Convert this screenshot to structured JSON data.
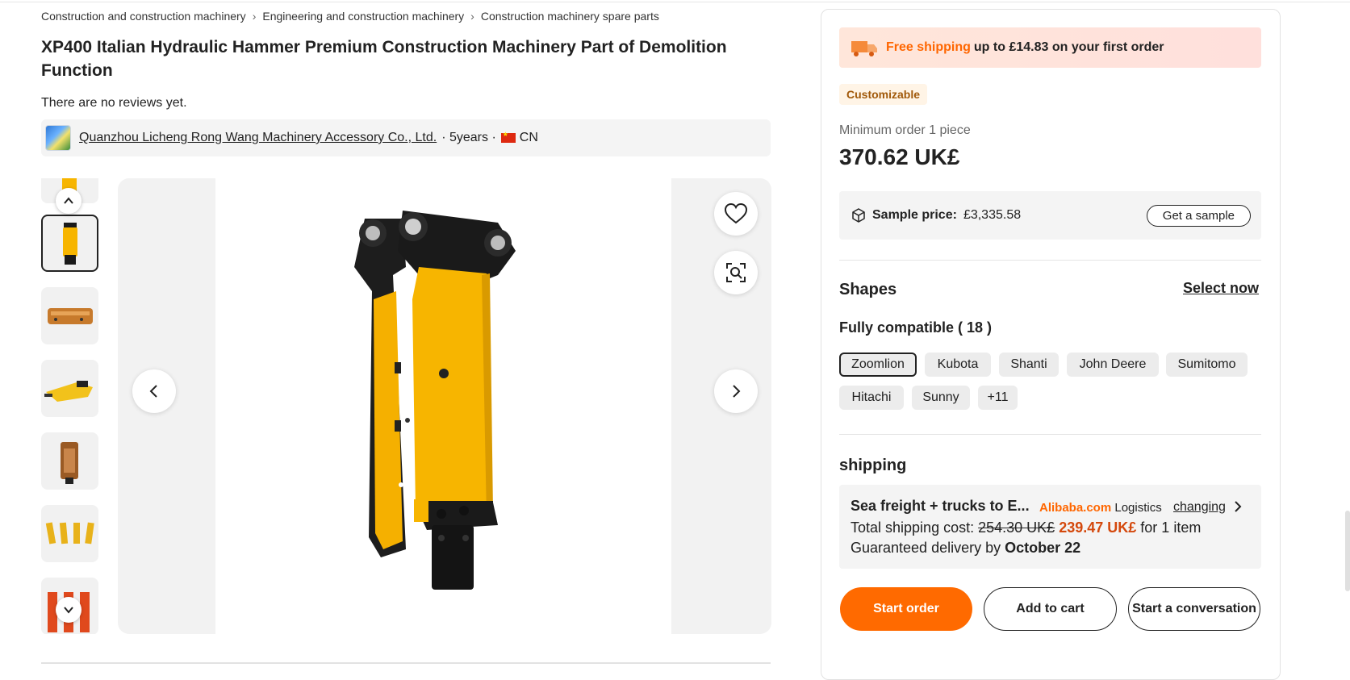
{
  "breadcrumb": {
    "items": [
      "Construction and construction machinery",
      "Engineering and construction machinery",
      "Construction machinery spare parts"
    ],
    "separator": ">"
  },
  "product": {
    "title": "XP400 Italian Hydraulic Hammer Premium Construction Machinery Part of Demolition Function",
    "reviews_text": "There are no reviews yet."
  },
  "supplier": {
    "name": "Quanzhou Licheng Rong Wang Machinery Accessory Co., Ltd.",
    "years": "· 5years ·",
    "country": "CN"
  },
  "gallery": {
    "thumbnail_count": 7,
    "active_thumbnail": 1,
    "icons": {
      "favorite": "heart-icon",
      "visual_search": "image-search-icon",
      "prev": "chevron-left-icon",
      "next": "chevron-right-icon",
      "thumb_up": "chevron-up-icon",
      "thumb_down": "chevron-down-icon"
    }
  },
  "promo": {
    "highlight": "Free shipping",
    "rest": "up to £14.83 on your first order"
  },
  "pricing": {
    "tag": "Customizable",
    "min_order": "Minimum order 1 piece",
    "price": "370.62 UK£",
    "sample_label": "Sample price:",
    "sample_value": "£3,335.58",
    "sample_button": "Get a sample"
  },
  "shapes": {
    "title": "Shapes",
    "select_now": "Select now",
    "compat_label": "Fully compatible ( 18 )",
    "chips": [
      "Zoomlion",
      "Kubota",
      "Shanti",
      "John Deere",
      "Sumitomo",
      "Hitachi",
      "Sunny",
      "+11"
    ],
    "selected": "Zoomlion"
  },
  "shipping": {
    "title": "shipping",
    "method": "Sea freight + trucks to E...",
    "brand": "Alibaba.com",
    "brand_suffix": "Logistics",
    "change": "changing",
    "cost_label": "Total shipping cost:",
    "old_cost": "254.30 UK£",
    "new_cost": "239.47 UK£",
    "cost_suffix": "for 1 item",
    "delivery_label": "Guaranteed delivery by",
    "delivery_date": "October 22"
  },
  "actions": {
    "start_order": "Start order",
    "add_to_cart": "Add to cart",
    "conversation": "Start a conversation"
  },
  "colors": {
    "accent": "#ff6a00",
    "hammer_yellow": "#f7b500",
    "hammer_black": "#1a1a1a"
  }
}
